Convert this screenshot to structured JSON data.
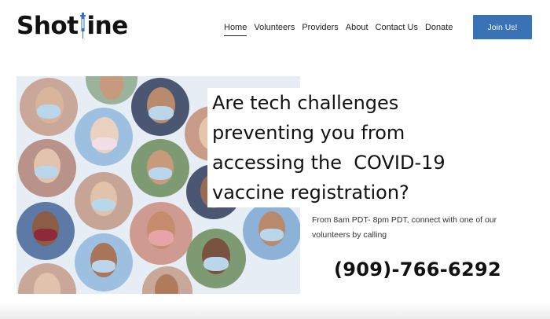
{
  "header": {
    "logo_text_left": "Shot",
    "logo_text_right": "ine",
    "nav": [
      {
        "label": "Home",
        "active": true
      },
      {
        "label": "Volunteers",
        "active": false
      },
      {
        "label": "Providers",
        "active": false
      },
      {
        "label": "About",
        "active": false
      },
      {
        "label": "Contact Us",
        "active": false
      },
      {
        "label": "Donate",
        "active": false
      }
    ],
    "cta_label": "Join Us!"
  },
  "hero": {
    "headline": [
      "Are tech challenges",
      "preventing you from",
      "accessing the  COVID-19",
      "vaccine registration?"
    ],
    "hours_text": "From 8am PDT- 8pm PDT, connect with one of our volunteers by calling",
    "phone": "(909)-766-6292"
  },
  "colors": {
    "brand_blue": "#3a72b6",
    "syringe_blue": "#2f6fc9",
    "hero_bg": "#e7edf4"
  }
}
